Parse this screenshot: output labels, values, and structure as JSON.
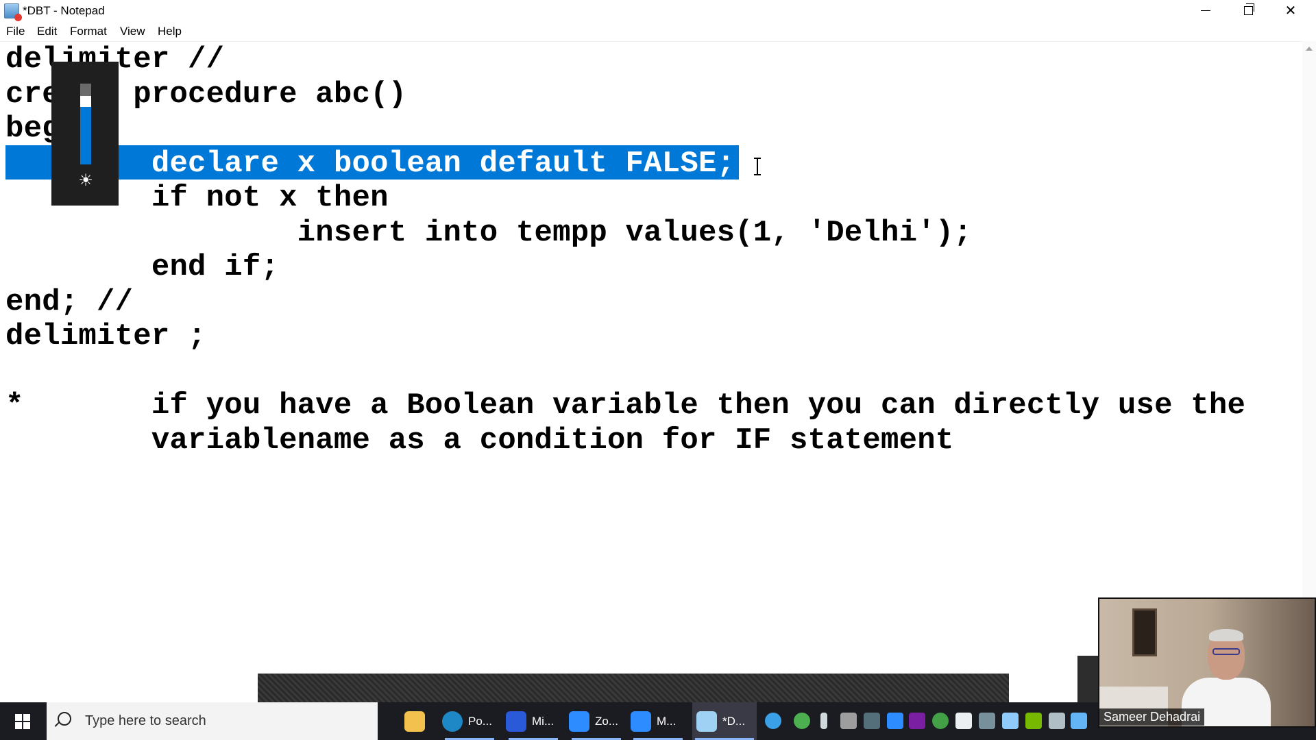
{
  "window": {
    "title": "*DBT - Notepad",
    "menu": [
      "File",
      "Edit",
      "Format",
      "View",
      "Help"
    ]
  },
  "editor": {
    "lines": [
      "delimiter //",
      "create procedure abc()",
      "begin",
      "        declare x boolean default FALSE;",
      "        if not x then",
      "                insert into tempp values(1, 'Delhi');",
      "        end if;",
      "end; //",
      "delimiter ;",
      "",
      "*       if you have a Boolean variable then you can directly use the",
      "        variablename as a condition for IF statement"
    ],
    "selected_line_index": 3
  },
  "overlay": {
    "brightness_icon": "sun-icon",
    "brightness_level": 0.85
  },
  "taskbar": {
    "search_placeholder": "Type here to search",
    "apps": [
      {
        "icon": "file-explorer-icon",
        "label": ""
      },
      {
        "icon": "edge-icon",
        "label": "Po..."
      },
      {
        "icon": "whiteboard-icon",
        "label": "Mi..."
      },
      {
        "icon": "zoom-icon",
        "label": "Zo..."
      },
      {
        "icon": "zoom-meeting-icon",
        "label": "M..."
      },
      {
        "icon": "notepad-icon",
        "label": "*D..."
      }
    ],
    "accent": "#0078d7"
  },
  "video": {
    "participant_name": "Sameer Dehadrai"
  }
}
